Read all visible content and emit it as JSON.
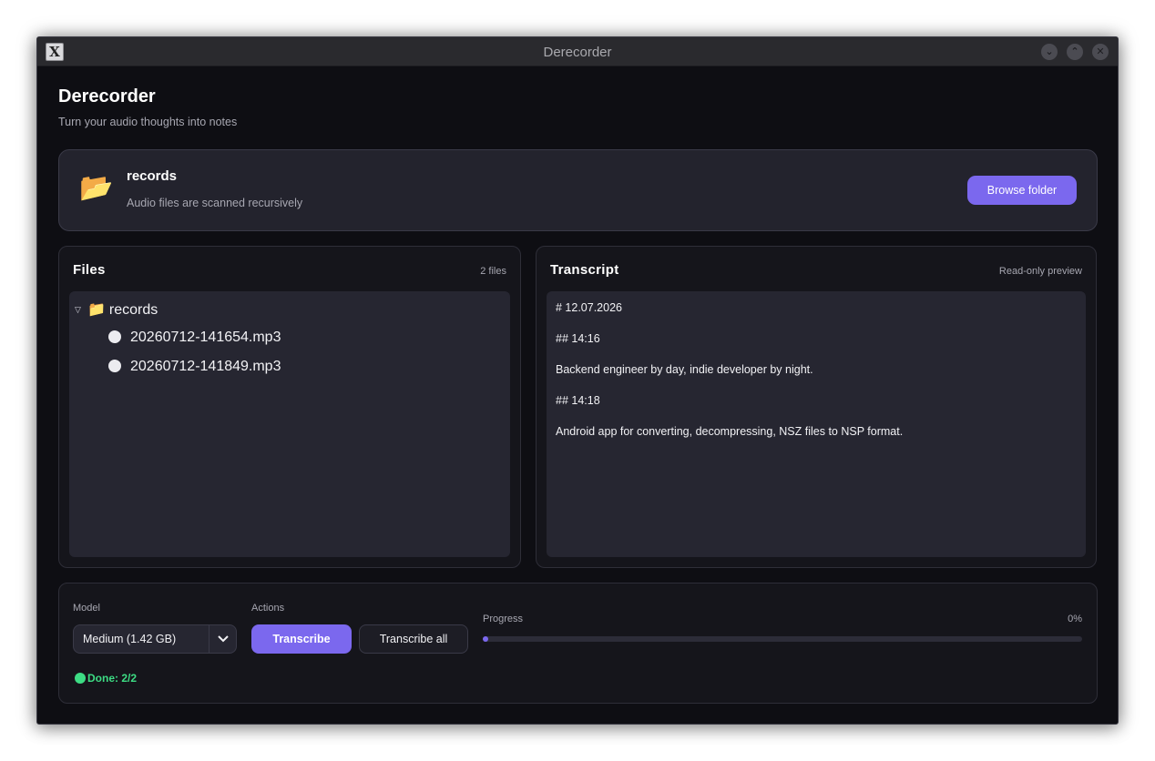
{
  "window": {
    "title": "Derecorder",
    "app_icon": "X",
    "controls": {
      "minimize": "⌄",
      "maximize": "⌃",
      "close": "✕"
    }
  },
  "header": {
    "title": "Derecorder",
    "subtitle": "Turn your audio thoughts into notes"
  },
  "folder": {
    "icon": "open-folder-icon",
    "icon_glyph": "📂",
    "name": "records",
    "hint": "Audio files are scanned recursively",
    "browse_label": "Browse folder"
  },
  "files": {
    "title": "Files",
    "count": "2 files",
    "tree": {
      "toggle": "▽",
      "folder_glyph": "📁",
      "folder_name": "records",
      "items": [
        {
          "name": "20260712-141654.mp3"
        },
        {
          "name": "20260712-141849.mp3"
        }
      ]
    }
  },
  "transcript": {
    "title": "Transcript",
    "meta": "Read-only preview",
    "lines": [
      "# 12.07.2026",
      "## 14:16",
      "Backend engineer by day, indie developer by night.",
      "## 14:18",
      "Android app for converting, decompressing, NSZ files to NSP format."
    ]
  },
  "controls": {
    "model_label": "Model",
    "model_value": "Medium (1.42 GB)",
    "actions_label": "Actions",
    "transcribe_label": "Transcribe",
    "transcribe_all_label": "Transcribe all",
    "progress_label": "Progress",
    "progress_text": "0%",
    "progress_value": 0,
    "status_text": "Done: 2/2"
  },
  "colors": {
    "accent": "#7b68ee",
    "success": "#3ddc84",
    "background": "#0e0e13"
  }
}
